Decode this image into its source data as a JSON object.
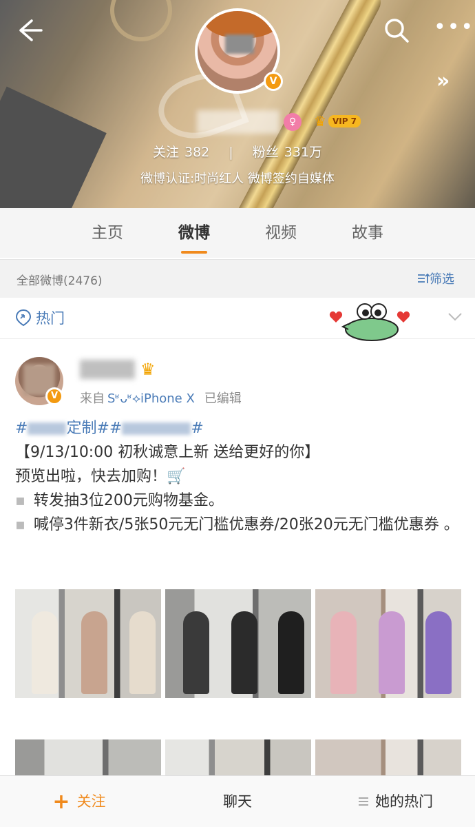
{
  "header": {
    "stats": {
      "follow_label": "关注",
      "follow_count": "382",
      "fans_label": "粉丝",
      "fans_count": "331万"
    },
    "verification": "微博认证:时尚红人 微博签约自媒体",
    "vip_label": "VIP 7",
    "icons": [
      "back-arrow-icon",
      "search-icon",
      "more-icon",
      "expand-icon",
      "verified-v-icon",
      "gender-female-icon",
      "vip-crown-icon"
    ]
  },
  "tabs": [
    {
      "label": "主页",
      "active": false
    },
    {
      "label": "微博",
      "active": true
    },
    {
      "label": "视频",
      "active": false
    },
    {
      "label": "故事",
      "active": false
    }
  ],
  "filter_bar": {
    "all_posts": "全部微博(2476)",
    "filter_label": "筛选"
  },
  "hot_bar": {
    "label": "热门"
  },
  "post": {
    "source_prefix": "来自",
    "source_device": "Sʶᴗʶ⟡iPhone X",
    "edited": "已编辑",
    "tag1_suffix": "定制",
    "tag_hash": "#",
    "line1": "【9/13/10:00 初秋诚意上新 送给更好的你】",
    "line2": "预览出啦，快去加购！",
    "bullet1": "转发抽3位200元购物基金。",
    "bullet2": "喊停3件新衣/5张50元无门槛优惠券/20张20元无门槛优惠券 。"
  },
  "bottom_bar": {
    "follow": "关注",
    "chat": "聊天",
    "her_hot": "她的热门"
  },
  "colors": {
    "accent_orange": "#f08a1d",
    "link_blue": "#4a7bb7"
  }
}
